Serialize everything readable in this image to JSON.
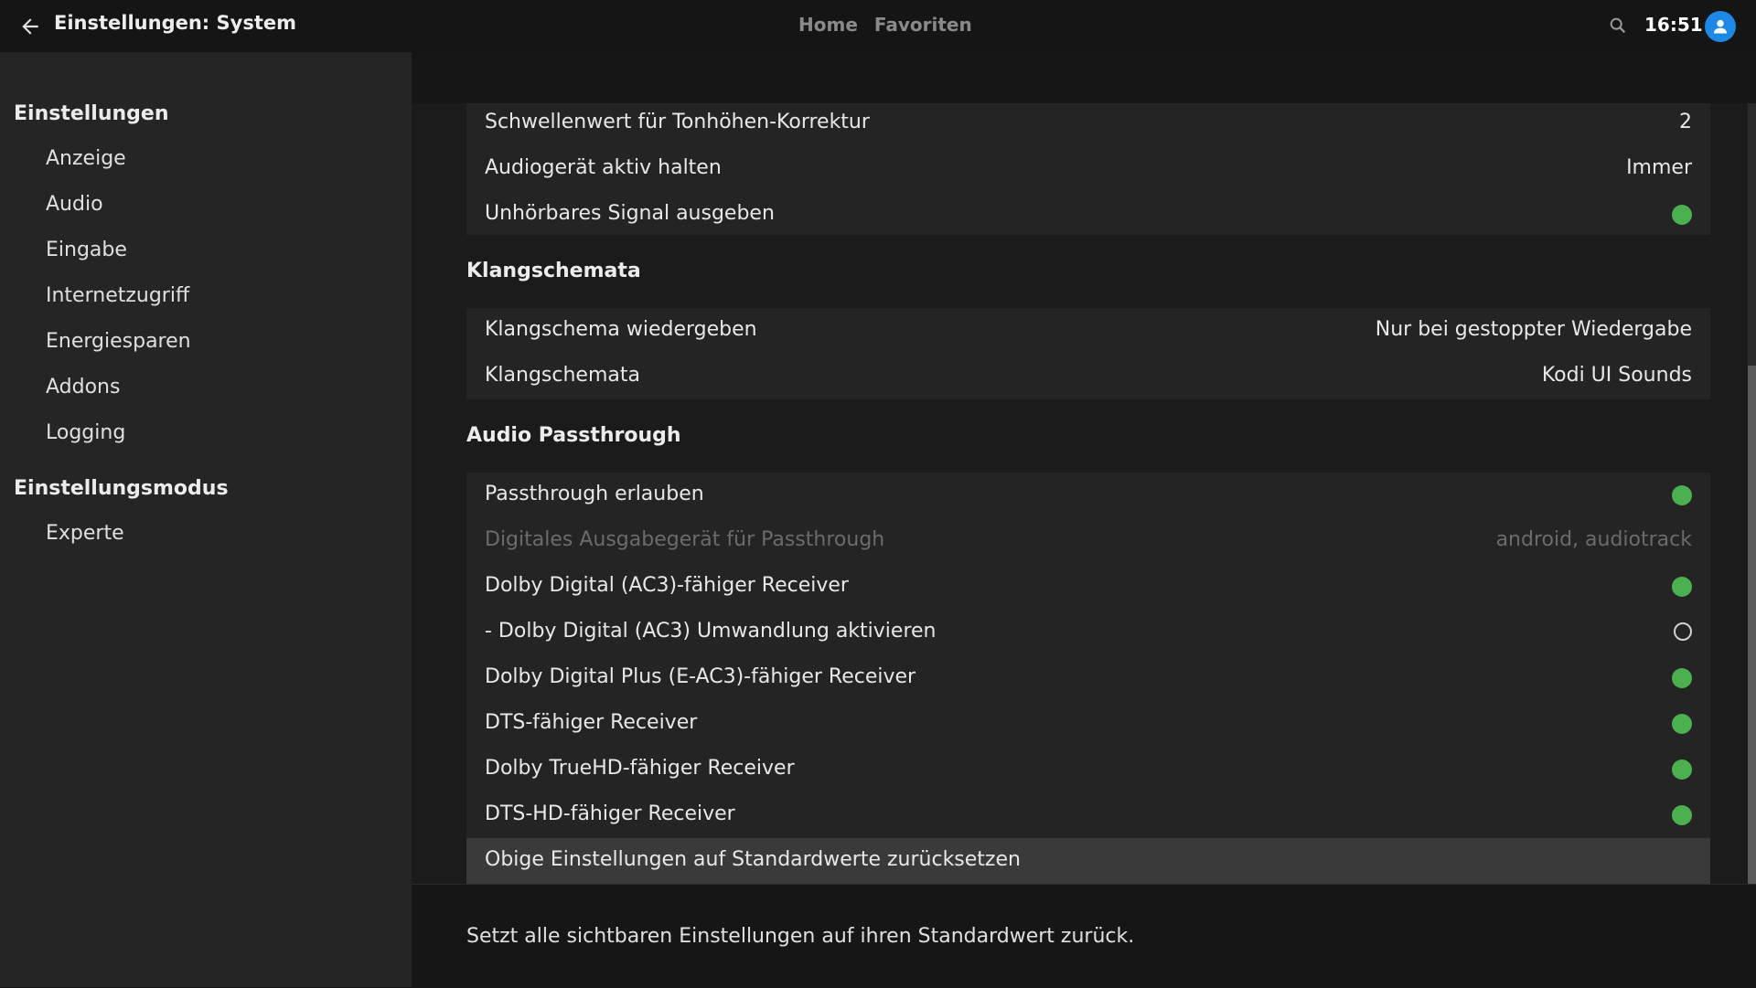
{
  "header": {
    "title": "Einstellungen: System",
    "nav": [
      "Home",
      "Favoriten"
    ],
    "clock": "16:51",
    "icons": {
      "back": "arrow-left-icon",
      "search": "search-icon",
      "profile": "user-icon"
    },
    "avatar_color": "#1e88e5"
  },
  "sidebar": {
    "sections": [
      {
        "title": "Einstellungen",
        "items": [
          "Anzeige",
          "Audio",
          "Eingabe",
          "Internetzugriff",
          "Energiesparen",
          "Addons",
          "Logging"
        ]
      },
      {
        "title": "Einstellungsmodus",
        "items": [
          "Experte"
        ]
      }
    ]
  },
  "content": {
    "group_top": [
      {
        "label": "Schwellenwert für Tonhöhen-Korrektur",
        "value": "2"
      },
      {
        "label": "Audiogerät aktiv halten",
        "value": "Immer"
      },
      {
        "label": "Unhörbares Signal ausgeben",
        "toggle": true
      }
    ],
    "sections": [
      {
        "title": "Klangschemata",
        "rows": [
          {
            "label": "Klangschema wiedergeben",
            "value": "Nur bei gestoppter Wiedergabe"
          },
          {
            "label": "Klangschemata",
            "value": "Kodi UI Sounds"
          }
        ]
      },
      {
        "title": "Audio Passthrough",
        "rows": [
          {
            "label": "Passthrough erlauben",
            "toggle": true
          },
          {
            "label": "Digitales Ausgabegerät für Passthrough",
            "value": "android, audiotrack",
            "disabled": true
          },
          {
            "label": "Dolby Digital (AC3)-fähiger Receiver",
            "toggle": true
          },
          {
            "label": "- Dolby Digital (AC3) Umwandlung aktivieren",
            "toggle": false
          },
          {
            "label": "Dolby Digital Plus (E-AC3)-fähiger Receiver",
            "toggle": true
          },
          {
            "label": "DTS-fähiger Receiver",
            "toggle": true
          },
          {
            "label": "Dolby TrueHD-fähiger Receiver",
            "toggle": true
          },
          {
            "label": "DTS-HD-fähiger Receiver",
            "toggle": true
          },
          {
            "label": "Obige Einstellungen auf Standardwerte zurücksetzen",
            "highlighted": true
          }
        ]
      }
    ]
  },
  "footer": {
    "description": "Setzt alle sichtbaren Einstellungen auf ihren Standardwert zurück."
  },
  "colors": {
    "toggle_on": "#4caf50",
    "background": "#151515",
    "sidebar": "#252525",
    "row_group": "#242424",
    "highlight": "#3a3a3a"
  }
}
